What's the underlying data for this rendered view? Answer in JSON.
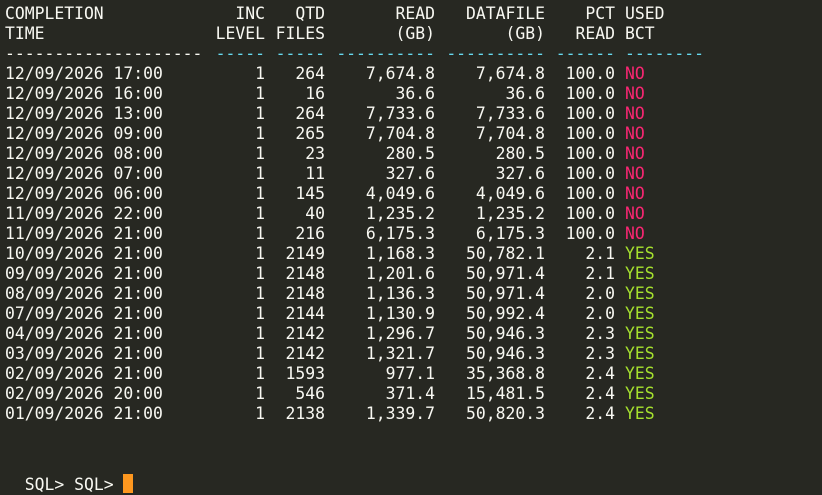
{
  "header": {
    "row1": {
      "time": "COMPLETION",
      "inc": "INC",
      "qtd": "QTD",
      "read": "READ",
      "datafile": "DATAFILE",
      "pct": "PCT",
      "bct": "USED"
    },
    "row2": {
      "time": "TIME",
      "inc": "LEVEL",
      "qtd": "FILES",
      "read": "(GB)",
      "datafile": "(GB)",
      "pct": "READ",
      "bct": "BCT"
    },
    "separator": {
      "time": "--------------------",
      "inc": "-----",
      "qtd": "-----",
      "read": "----------",
      "datafile": "----------",
      "pct": "------",
      "bct": "--------"
    }
  },
  "rows": [
    {
      "time": "12/09/2026 17:00",
      "inc": "1",
      "qtd": "264",
      "read": "7,674.8",
      "datafile": "7,674.8",
      "pct": "100.0",
      "bct": "NO"
    },
    {
      "time": "12/09/2026 16:00",
      "inc": "1",
      "qtd": "16",
      "read": "36.6",
      "datafile": "36.6",
      "pct": "100.0",
      "bct": "NO"
    },
    {
      "time": "12/09/2026 13:00",
      "inc": "1",
      "qtd": "264",
      "read": "7,733.6",
      "datafile": "7,733.6",
      "pct": "100.0",
      "bct": "NO"
    },
    {
      "time": "12/09/2026 09:00",
      "inc": "1",
      "qtd": "265",
      "read": "7,704.8",
      "datafile": "7,704.8",
      "pct": "100.0",
      "bct": "NO"
    },
    {
      "time": "12/09/2026 08:00",
      "inc": "1",
      "qtd": "23",
      "read": "280.5",
      "datafile": "280.5",
      "pct": "100.0",
      "bct": "NO"
    },
    {
      "time": "12/09/2026 07:00",
      "inc": "1",
      "qtd": "11",
      "read": "327.6",
      "datafile": "327.6",
      "pct": "100.0",
      "bct": "NO"
    },
    {
      "time": "12/09/2026 06:00",
      "inc": "1",
      "qtd": "145",
      "read": "4,049.6",
      "datafile": "4,049.6",
      "pct": "100.0",
      "bct": "NO"
    },
    {
      "time": "11/09/2026 22:00",
      "inc": "1",
      "qtd": "40",
      "read": "1,235.2",
      "datafile": "1,235.2",
      "pct": "100.0",
      "bct": "NO"
    },
    {
      "time": "11/09/2026 21:00",
      "inc": "1",
      "qtd": "216",
      "read": "6,175.3",
      "datafile": "6,175.3",
      "pct": "100.0",
      "bct": "NO"
    },
    {
      "time": "10/09/2026 21:00",
      "inc": "1",
      "qtd": "2149",
      "read": "1,168.3",
      "datafile": "50,782.1",
      "pct": "2.1",
      "bct": "YES"
    },
    {
      "time": "09/09/2026 21:00",
      "inc": "1",
      "qtd": "2148",
      "read": "1,201.6",
      "datafile": "50,971.4",
      "pct": "2.1",
      "bct": "YES"
    },
    {
      "time": "08/09/2026 21:00",
      "inc": "1",
      "qtd": "2148",
      "read": "1,136.3",
      "datafile": "50,971.4",
      "pct": "2.0",
      "bct": "YES"
    },
    {
      "time": "07/09/2026 21:00",
      "inc": "1",
      "qtd": "2144",
      "read": "1,130.9",
      "datafile": "50,992.4",
      "pct": "2.0",
      "bct": "YES"
    },
    {
      "time": "04/09/2026 21:00",
      "inc": "1",
      "qtd": "2142",
      "read": "1,296.7",
      "datafile": "50,946.3",
      "pct": "2.3",
      "bct": "YES"
    },
    {
      "time": "03/09/2026 21:00",
      "inc": "1",
      "qtd": "2142",
      "read": "1,321.7",
      "datafile": "50,946.3",
      "pct": "2.3",
      "bct": "YES"
    },
    {
      "time": "02/09/2026 21:00",
      "inc": "1",
      "qtd": "1593",
      "read": "977.1",
      "datafile": "35,368.8",
      "pct": "2.4",
      "bct": "YES"
    },
    {
      "time": "02/09/2026 20:00",
      "inc": "1",
      "qtd": "546",
      "read": "371.4",
      "datafile": "15,481.5",
      "pct": "2.4",
      "bct": "YES"
    },
    {
      "time": "01/09/2026 21:00",
      "inc": "1",
      "qtd": "2138",
      "read": "1,339.7",
      "datafile": "50,820.3",
      "pct": "2.4",
      "bct": "YES"
    }
  ],
  "prompt": {
    "text": "SQL> SQL> "
  },
  "colors": {
    "background": "#272822",
    "foreground": "#f8f8f2",
    "separator": "#66d9ef",
    "no": "#f92672",
    "yes": "#a6e22e",
    "cursor": "#fd971f"
  }
}
